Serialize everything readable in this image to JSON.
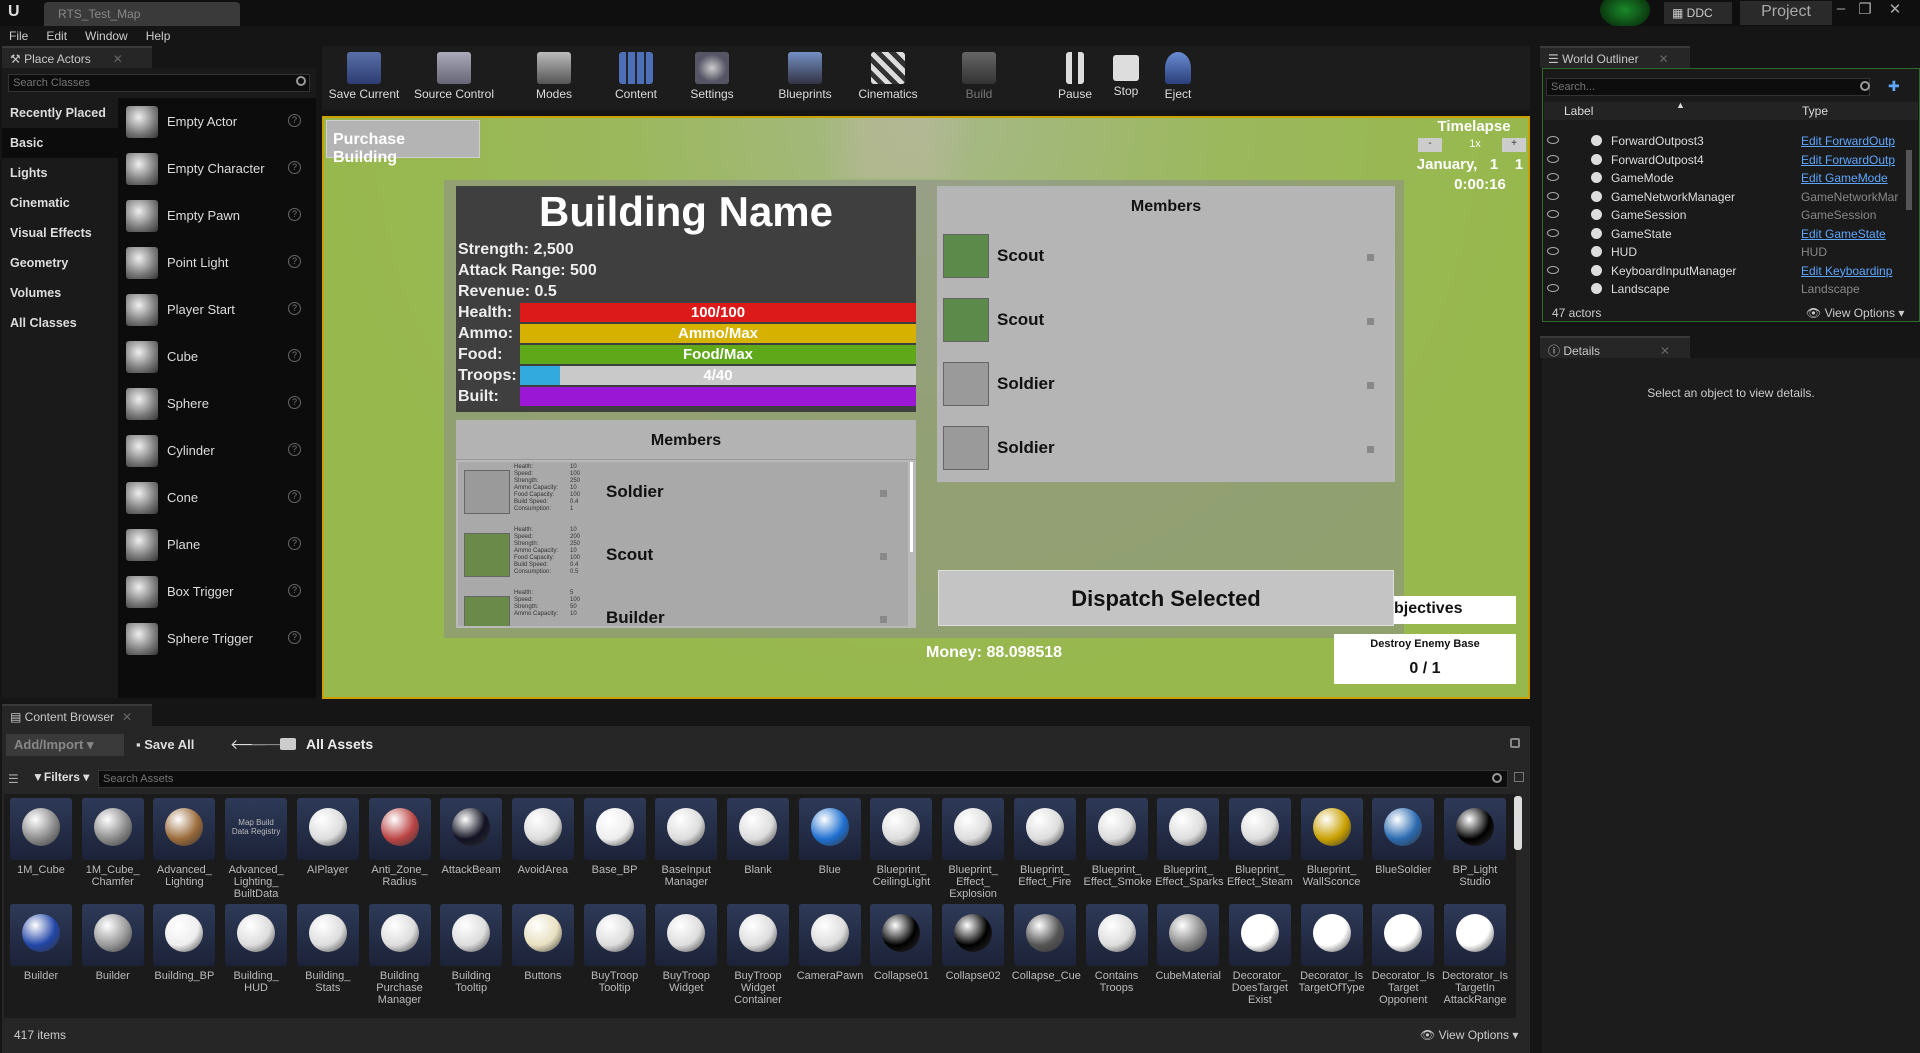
{
  "window": {
    "tab": "RTS_Test_Map",
    "ddc": "DDC",
    "project": "Project"
  },
  "menu": [
    "File",
    "Edit",
    "Window",
    "Help"
  ],
  "place_actors": {
    "title": "Place Actors",
    "search_placeholder": "Search Classes",
    "categories": [
      "Recently Placed",
      "Basic",
      "Lights",
      "Cinematic",
      "Visual Effects",
      "Geometry",
      "Volumes",
      "All Classes"
    ],
    "selected": "Basic",
    "actors": [
      "Empty Actor",
      "Empty Character",
      "Empty Pawn",
      "Point Light",
      "Player Start",
      "Cube",
      "Sphere",
      "Cylinder",
      "Cone",
      "Plane",
      "Box Trigger",
      "Sphere Trigger"
    ]
  },
  "toolbar": [
    "Save Current",
    "Source Control",
    "Modes",
    "Content",
    "Settings",
    "Blueprints",
    "Cinematics",
    "Build",
    "Pause",
    "Stop",
    "Eject"
  ],
  "viewport": {
    "purchase_button": "Purchase Building",
    "timelapse": {
      "label": "Timelapse",
      "speed": "1x",
      "minus": "-",
      "plus": "+",
      "date": "January,   1    1",
      "time": "0:00:16"
    },
    "building": {
      "name": "Building Name",
      "strength": "Strength: 2,500",
      "attack_range": "Attack Range: 500",
      "revenue": "Revenue: 0.5",
      "bars": [
        {
          "label": "Health:",
          "text": "100/100",
          "fill": 1.0,
          "color": "#dd1a1a"
        },
        {
          "label": "Ammo:",
          "text": "Ammo/Max",
          "fill": 1.0,
          "color": "#d7b100"
        },
        {
          "label": "Food:",
          "text": "Food/Max",
          "fill": 1.0,
          "color": "#5fa81a"
        },
        {
          "label": "Troops:",
          "text": "4/40",
          "fill": 0.1,
          "color": "#33aadd"
        },
        {
          "label": "Built:",
          "text": "",
          "fill": 1.0,
          "color": "#9b17d6"
        }
      ]
    },
    "members_left": {
      "title": "Members",
      "rows": [
        {
          "name": "Soldier",
          "stats": [
            "Health:",
            "Speed:",
            "Strength:",
            "Ammo Capacity:",
            "Food Capacity:",
            "Build Speed:",
            "Consumption:"
          ],
          "values": [
            "10",
            "100",
            "250",
            "10",
            "100",
            "0.4",
            "1"
          ]
        },
        {
          "name": "Scout",
          "stats": [
            "Health:",
            "Speed:",
            "Strength:",
            "Ammo Capacity:",
            "Food Capacity:",
            "Build Speed:",
            "Consumption:"
          ],
          "values": [
            "10",
            "200",
            "250",
            "10",
            "100",
            "0.4",
            "0.5"
          ]
        },
        {
          "name": "Builder",
          "stats": [
            "Health:",
            "Speed:",
            "Strength:",
            "Ammo Capacity:"
          ],
          "values": [
            "5",
            "100",
            "50",
            "10"
          ]
        }
      ]
    },
    "members_right": {
      "title": "Members",
      "rows": [
        "Scout",
        "Scout",
        "Soldier",
        "Soldier"
      ]
    },
    "dispatch": "Dispatch Selected",
    "money": "Money: 88.098518",
    "objectives": {
      "title": "bjectives",
      "item": "Destroy Enemy Base",
      "progress": "0 / 1"
    }
  },
  "outliner": {
    "title": "World Outliner",
    "search_placeholder": "Search...",
    "col_label": "Label",
    "col_type": "Type",
    "rows": [
      {
        "label": "ForwardOutpost3",
        "type": "Edit ForwardOutp",
        "link": true
      },
      {
        "label": "ForwardOutpost4",
        "type": "Edit ForwardOutp",
        "link": true
      },
      {
        "label": "GameMode",
        "type": "Edit GameMode",
        "link": true
      },
      {
        "label": "GameNetworkManager",
        "type": "GameNetworkMar",
        "link": false
      },
      {
        "label": "GameSession",
        "type": "GameSession",
        "link": false
      },
      {
        "label": "GameState",
        "type": "Edit GameState",
        "link": true
      },
      {
        "label": "HUD",
        "type": "HUD",
        "link": false
      },
      {
        "label": "KeyboardInputManager",
        "type": "Edit Keyboardinp",
        "link": true
      },
      {
        "label": "Landscape",
        "type": "Landscape",
        "link": false
      }
    ],
    "count": "47 actors",
    "view_options": "View Options"
  },
  "details": {
    "title": "Details",
    "empty": "Select an object to view details."
  },
  "content_browser": {
    "title": "Content Browser",
    "add_import": "Add/Import",
    "save_all": "Save All",
    "path": "All Assets",
    "filters": "Filters",
    "search_placeholder": "Search Assets",
    "count": "417 items",
    "view_options": "View Options",
    "row1": [
      "1M_Cube",
      "1M_Cube_\nChamfer",
      "Advanced_\nLighting",
      "Advanced_\nLighting_\nBuiltData",
      "AIPlayer",
      "Anti_Zone_\nRadius",
      "AttackBeam",
      "AvoidArea",
      "Base_BP",
      "BaseInput\nManager",
      "Blank",
      "Blue",
      "Blueprint_\nCeilingLight",
      "Blueprint_\nEffect_\nExplosion",
      "Blueprint_\nEffect_Fire",
      "Blueprint_\nEffect_Smoke",
      "Blueprint_\nEffect_Sparks",
      "Blueprint_\nEffect_Steam",
      "Blueprint_\nWallSconce",
      "BlueSoldier",
      "BP_Light\nStudio"
    ],
    "row2": [
      "Builder",
      "Builder",
      "Building_BP",
      "Building_\nHUD",
      "Building_\nStats",
      "Building\nPurchase\nManager",
      "Building\nTooltip",
      "Buttons",
      "BuyTroop\nTooltip",
      "BuyTroop\nWidget",
      "BuyTroop\nWidget\nContainer",
      "CameraPawn",
      "Collapse01",
      "Collapse02",
      "Collapse_Cue",
      "Contains\nTroops",
      "CubeMaterial",
      "Decorator_\nDoesTarget\nExist",
      "Decorator_Is\nTargetOfType",
      "Decorator_Is\nTarget\nOpponent",
      "Dectorator_Is\nTargetIn\nAttackRange"
    ],
    "map_build_label": "Map Build\nData Registry"
  }
}
